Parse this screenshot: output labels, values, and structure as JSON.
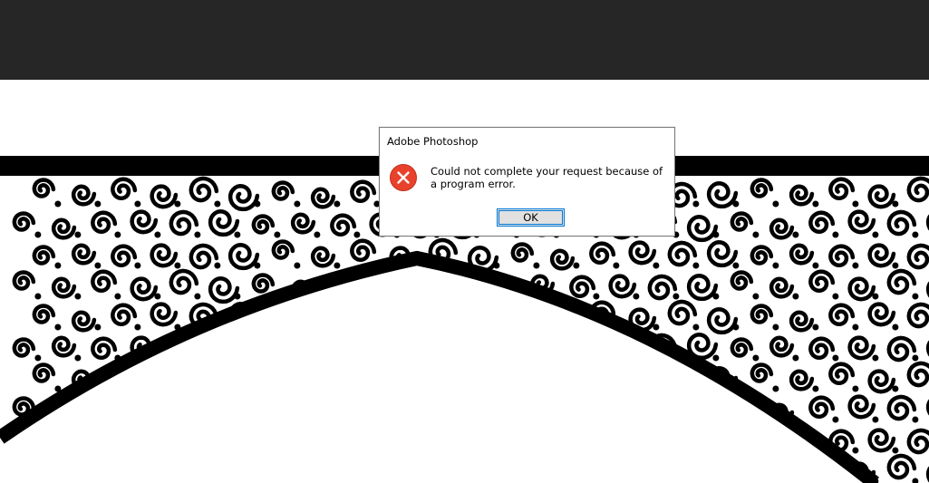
{
  "app": {
    "name": "Adobe Photoshop",
    "topbar_color": "#262626"
  },
  "canvas": {
    "content": "ornamental-arch-scrollwork",
    "ink_color": "#000000",
    "paper_color": "#ffffff"
  },
  "dialog": {
    "title": "Adobe Photoshop",
    "icon": "error-icon",
    "icon_color": "#e8412c",
    "message": "Could not complete your request because of a program error.",
    "ok_label": "OK",
    "accent_color": "#0078d7"
  }
}
